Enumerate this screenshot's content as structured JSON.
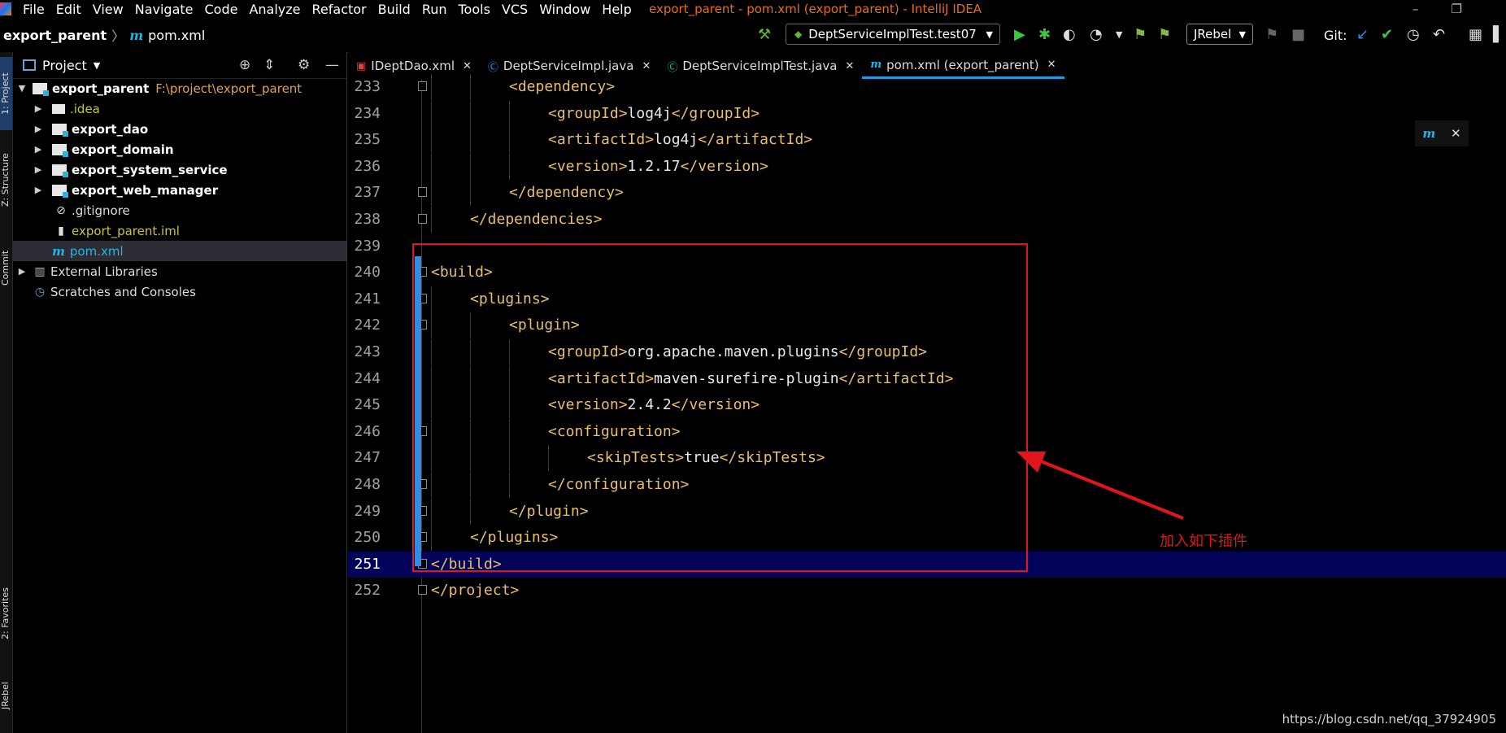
{
  "menubar": {
    "items": [
      "File",
      "Edit",
      "View",
      "Navigate",
      "Code",
      "Analyze",
      "Refactor",
      "Build",
      "Run",
      "Tools",
      "VCS",
      "Window",
      "Help"
    ],
    "title": "export_parent - pom.xml (export_parent) - IntelliJ IDEA"
  },
  "navbar": {
    "project": "export_parent",
    "file": "pom.xml",
    "run_config": "DeptServiceImplTest.test07",
    "jrebel": "JRebel",
    "git": "Git:"
  },
  "sidebar": {
    "project_label": "1: Project",
    "structure_label": "Z: Structure",
    "commit_label": "Commit",
    "favorites_label": "2: Favorites",
    "jrebel_label": "JRebel"
  },
  "project_panel": {
    "title": "Project",
    "root": {
      "name": "export_parent",
      "path": "F:\\project\\export_parent"
    },
    "items": [
      {
        "name": ".idea"
      },
      {
        "name": "export_dao"
      },
      {
        "name": "export_domain"
      },
      {
        "name": "export_system_service"
      },
      {
        "name": "export_web_manager"
      },
      {
        "name": ".gitignore"
      },
      {
        "name": "export_parent.iml"
      },
      {
        "name": "pom.xml"
      },
      {
        "name": "External Libraries"
      },
      {
        "name": "Scratches and Consoles"
      }
    ]
  },
  "tabs": [
    {
      "label": "IDeptDao.xml",
      "icon": "xml-icon"
    },
    {
      "label": "DeptServiceImpl.java",
      "icon": "class-icon"
    },
    {
      "label": "DeptServiceImplTest.java",
      "icon": "test-class-icon"
    },
    {
      "label": "pom.xml (export_parent)",
      "icon": "maven-icon",
      "active": true
    }
  ],
  "editor": {
    "current_line": 251,
    "lines": [
      {
        "n": "233",
        "indent": 2,
        "code": "<dependency>"
      },
      {
        "n": "234",
        "indent": 3,
        "code": "<groupId>log4j</groupId>"
      },
      {
        "n": "235",
        "indent": 3,
        "code": "<artifactId>log4j</artifactId>"
      },
      {
        "n": "236",
        "indent": 3,
        "code": "<version>1.2.17</version>"
      },
      {
        "n": "237",
        "indent": 2,
        "code": "</dependency>"
      },
      {
        "n": "238",
        "indent": 1,
        "code": "</dependencies>"
      },
      {
        "n": "239",
        "indent": 0,
        "code": ""
      },
      {
        "n": "240",
        "indent": 0,
        "code": "<build>"
      },
      {
        "n": "241",
        "indent": 1,
        "code": "<plugins>"
      },
      {
        "n": "242",
        "indent": 2,
        "code": "<plugin>"
      },
      {
        "n": "243",
        "indent": 3,
        "code": "<groupId>org.apache.maven.plugins</groupId>"
      },
      {
        "n": "244",
        "indent": 3,
        "code": "<artifactId>maven-surefire-plugin</artifactId>"
      },
      {
        "n": "245",
        "indent": 3,
        "code": "<version>2.4.2</version>"
      },
      {
        "n": "246",
        "indent": 3,
        "code": "<configuration>"
      },
      {
        "n": "247",
        "indent": 4,
        "code": "<skipTests>true</skipTests>"
      },
      {
        "n": "248",
        "indent": 3,
        "code": "</configuration>"
      },
      {
        "n": "249",
        "indent": 2,
        "code": "</plugin>"
      },
      {
        "n": "250",
        "indent": 1,
        "code": "</plugins>"
      },
      {
        "n": "251",
        "indent": 0,
        "code": "</build>"
      },
      {
        "n": "252",
        "indent": 0,
        "code": "</project>"
      }
    ]
  },
  "annotation": "加入如下插件",
  "watermark": "https://blog.csdn.net/qq_37924905",
  "colors": {
    "accent": "#1f9be6",
    "annotation": "#e0161c",
    "tag": "#e8bf6a",
    "title": "#e66d17"
  }
}
